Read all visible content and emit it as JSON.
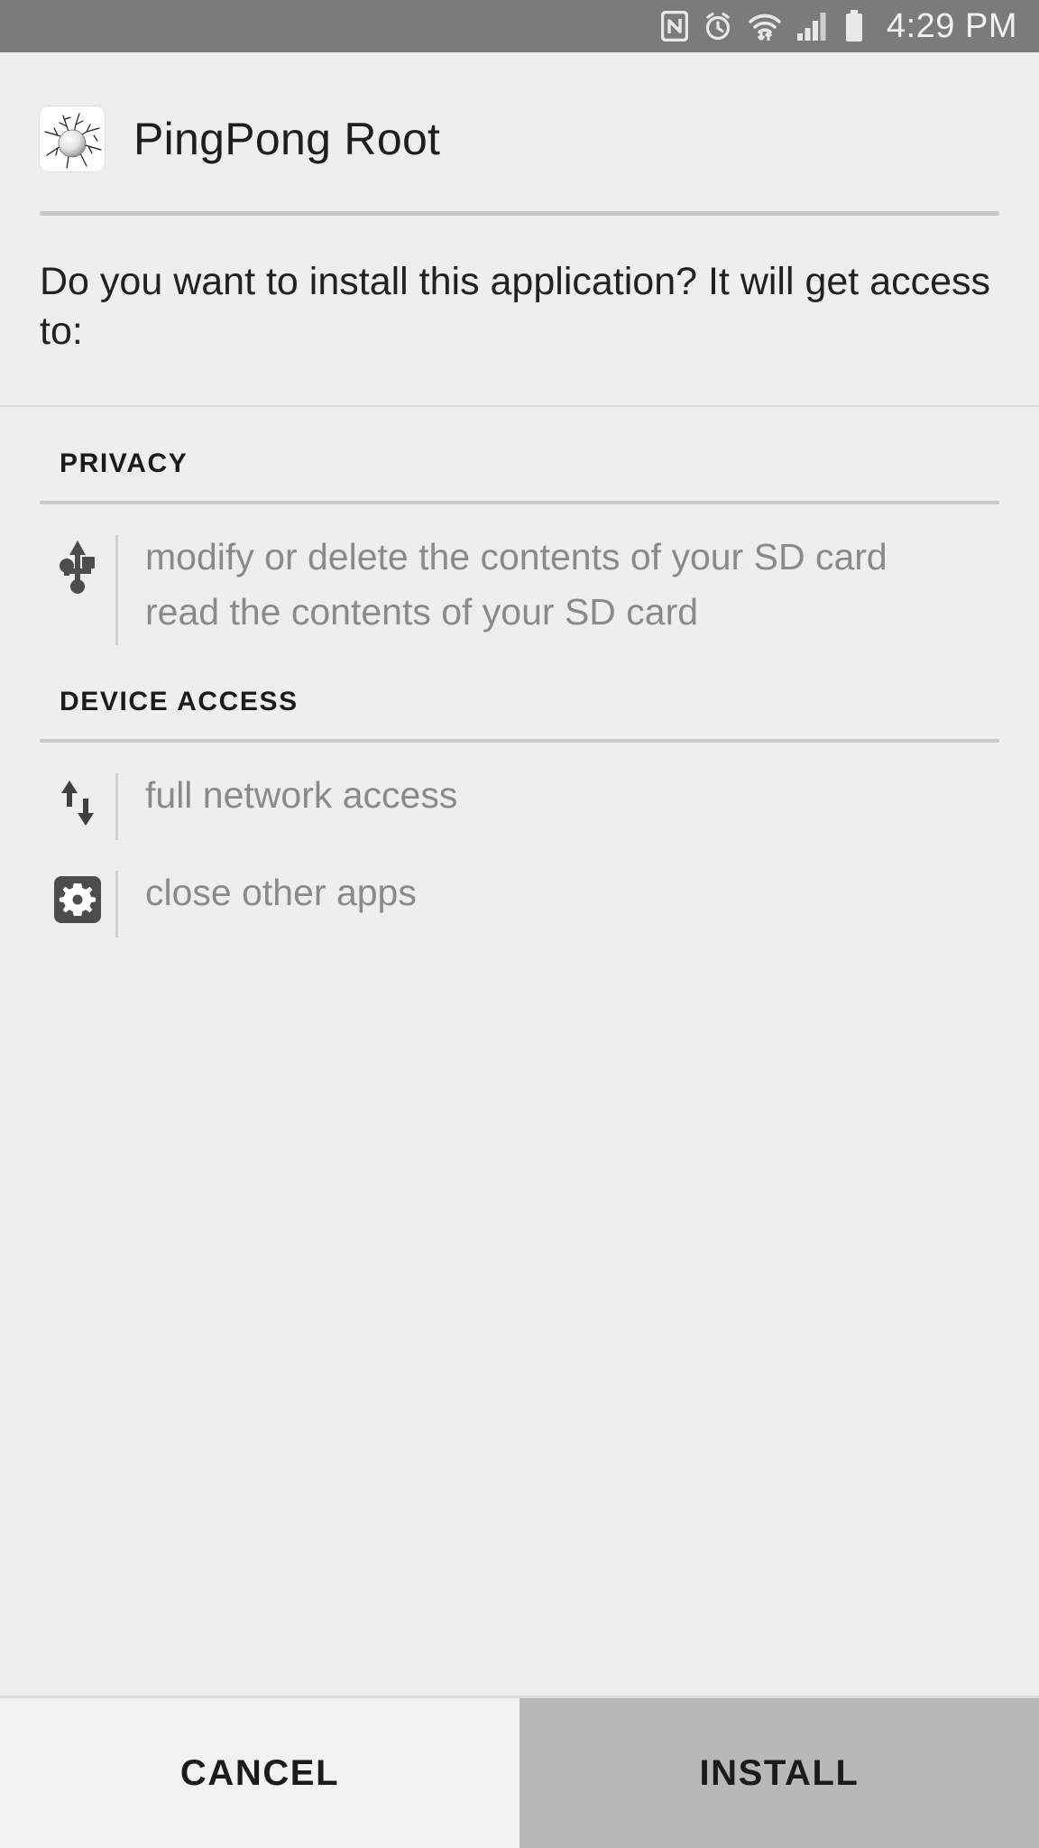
{
  "status_bar": {
    "time": "4:29 PM",
    "icons": [
      "nfc-icon",
      "alarm-icon",
      "wifi-transfer-icon",
      "cellular-signal-icon",
      "battery-icon"
    ],
    "background": "#7b7b7b",
    "foreground": "#f2f2f2"
  },
  "header": {
    "app_name": "PingPong Root",
    "app_icon": "cracked-ball-icon"
  },
  "prompt": {
    "text": "Do you want to install this application? It will get access to:"
  },
  "groups": [
    {
      "title": "PRIVACY",
      "rows": [
        {
          "icon": "usb-icon",
          "permissions": [
            "modify or delete the contents of your SD card",
            "read the contents of your SD card"
          ]
        }
      ]
    },
    {
      "title": "DEVICE ACCESS",
      "rows": [
        {
          "icon": "network-arrows-icon",
          "permissions": [
            "full network access"
          ]
        },
        {
          "icon": "gear-square-icon",
          "permissions": [
            "close other apps"
          ]
        }
      ]
    }
  ],
  "buttons": {
    "cancel_label": "CANCEL",
    "install_label": "INSTALL",
    "cancel_bg": "#f2f2f2",
    "install_bg": "#b8b8b8"
  },
  "colors": {
    "page_bg": "#eeeeee",
    "permission_text": "#8a8a8a",
    "heading_text": "#1b1b1b",
    "divider": "#c9c9c9"
  }
}
